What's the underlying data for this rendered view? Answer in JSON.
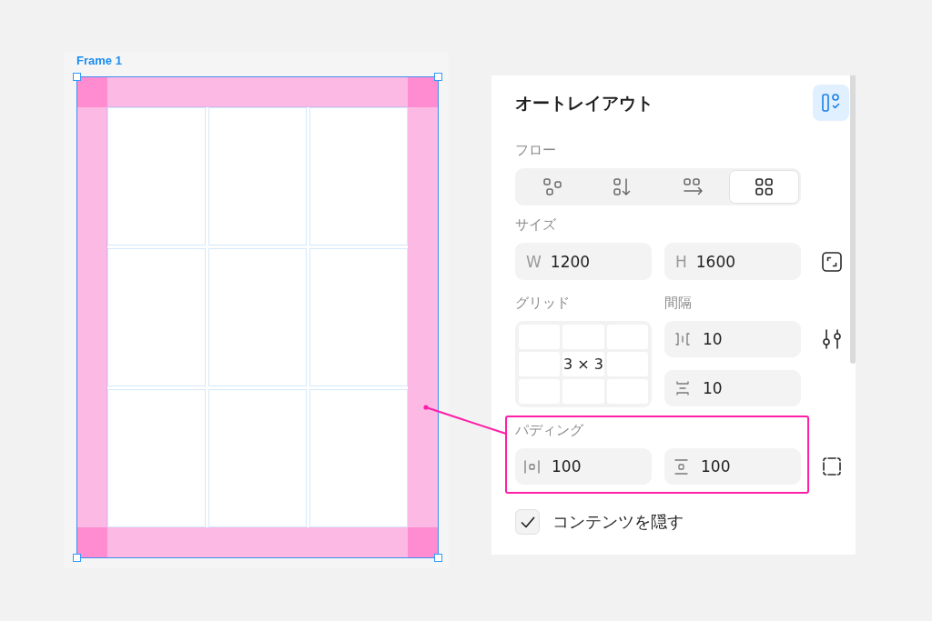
{
  "canvas": {
    "frame": {
      "label": "Frame 1",
      "selected": true
    }
  },
  "panel": {
    "title": "オートレイアウト",
    "auto_layout": {
      "on": true
    },
    "flow": {
      "label": "フロー",
      "options": [
        {
          "kind": "free",
          "selected": false
        },
        {
          "kind": "vertical",
          "selected": false
        },
        {
          "kind": "horizontal",
          "selected": false
        },
        {
          "kind": "grid",
          "selected": true
        }
      ]
    },
    "size": {
      "label": "サイズ",
      "fields": [
        {
          "prefix": "W",
          "value": "1200"
        },
        {
          "prefix": "H",
          "value": "1600"
        }
      ]
    },
    "grid": {
      "label": "グリッド",
      "value": "3 × 3"
    },
    "spacing": {
      "label": "間隔",
      "fields": [
        {
          "kind": "horizontal",
          "value": "10"
        },
        {
          "kind": "vertical",
          "value": "10"
        }
      ]
    },
    "padding": {
      "label": "パディング",
      "highlighted": true,
      "fields": [
        {
          "kind": "horizontal",
          "value": "100"
        },
        {
          "kind": "vertical",
          "value": "100"
        }
      ]
    },
    "hide_contents": {
      "label": "コンテンツを隠す",
      "checked": true
    }
  }
}
